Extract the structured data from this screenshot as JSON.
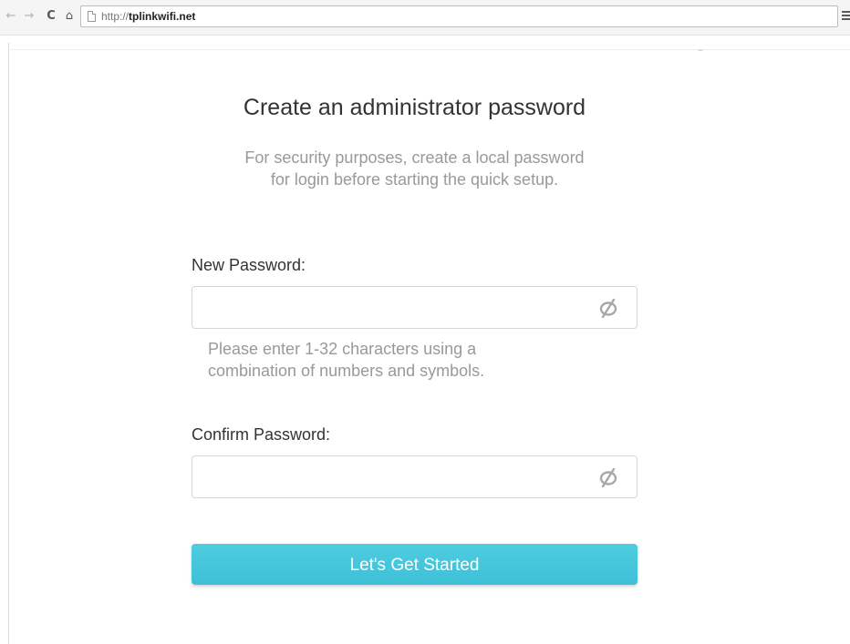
{
  "browser": {
    "back_glyph": "←",
    "forward_glyph": "→",
    "reload_glyph": "C",
    "home_glyph": "⌂",
    "url_prefix": "http://",
    "url_host": "tplinkwifi.net"
  },
  "form": {
    "title": "Create an administrator password",
    "subtitle_line1": "For security purposes, create a local password",
    "subtitle_line2": "for login before starting the quick setup.",
    "new_password_label": "New Password:",
    "new_password_value": "",
    "hint_line1": "Please enter 1-32 characters using a",
    "hint_line2": "combination of numbers and symbols.",
    "confirm_password_label": "Confirm Password:",
    "confirm_password_value": "",
    "submit_label": "Let's Get Started"
  },
  "icons": {
    "eye_toggle": "eye-hidden-icon",
    "menu": "hamburger-menu-icon",
    "page": "page-icon"
  },
  "colors": {
    "accent": "#45c6dc",
    "title_text": "#333333",
    "muted_text": "#999999",
    "input_border": "#d5d5d5"
  }
}
